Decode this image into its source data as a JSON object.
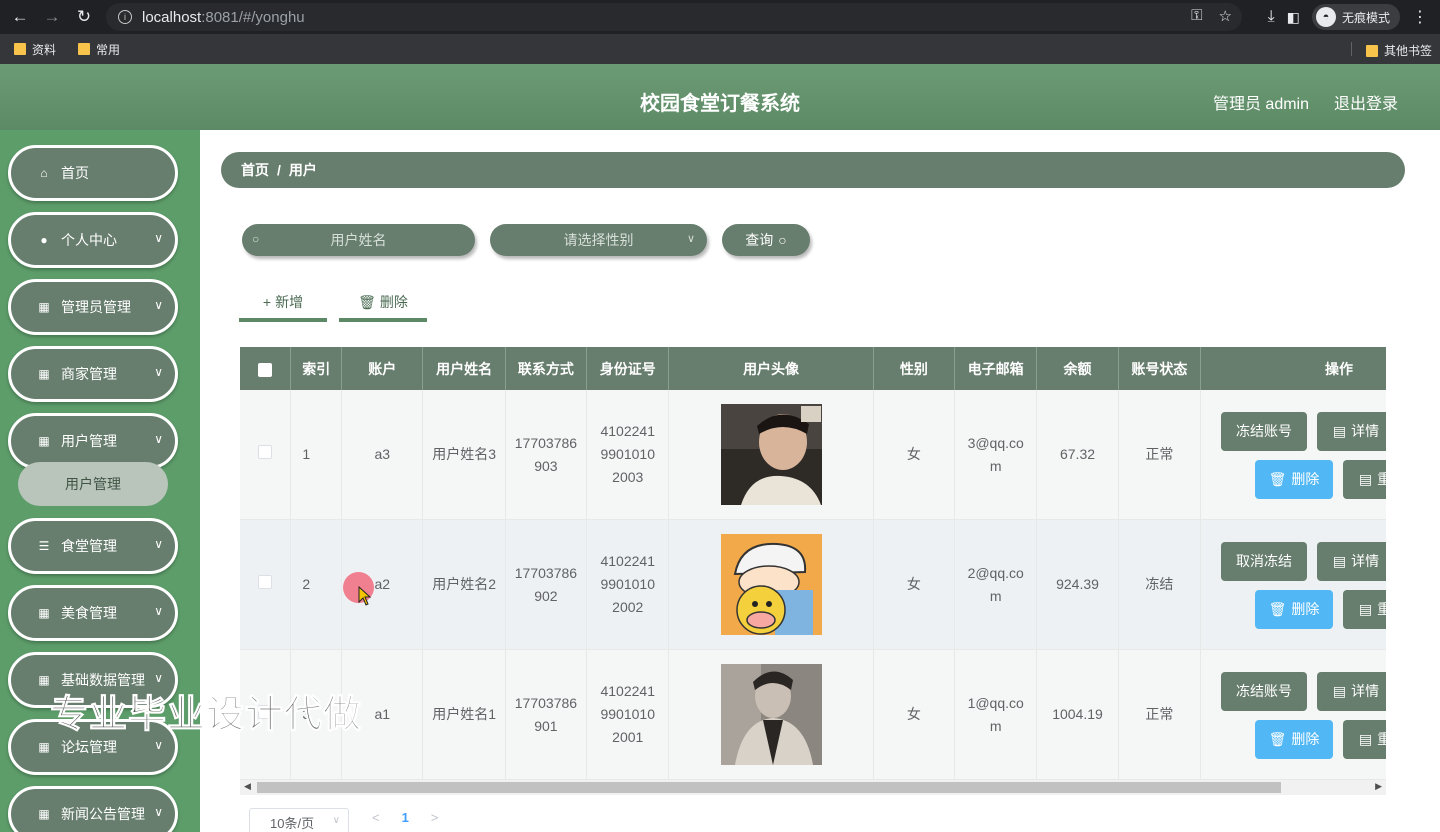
{
  "browser": {
    "url_host": "localhost",
    "url_rest": ":8081/#/yonghu",
    "incognito_label": "无痕模式",
    "bookmarks": [
      "资料",
      "常用"
    ],
    "other_bookmarks": "其他书签"
  },
  "header": {
    "title": "校园食堂订餐系统",
    "user": "管理员 admin",
    "logout": "退出登录"
  },
  "sidebar": {
    "items": [
      {
        "label": "首页",
        "icon": "home-icon"
      },
      {
        "label": "个人中心",
        "icon": "user-icon"
      },
      {
        "label": "管理员管理",
        "icon": "grid-icon"
      },
      {
        "label": "商家管理",
        "icon": "grid-icon"
      },
      {
        "label": "用户管理",
        "icon": "grid-icon"
      },
      {
        "label": "食堂管理",
        "icon": "sliders-icon"
      },
      {
        "label": "美食管理",
        "icon": "grid-icon"
      },
      {
        "label": "基础数据管理",
        "icon": "grid-icon"
      },
      {
        "label": "论坛管理",
        "icon": "grid-icon"
      },
      {
        "label": "新闻公告管理",
        "icon": "grid-icon"
      }
    ],
    "submenu": "用户管理"
  },
  "breadcrumb": {
    "home": "首页",
    "sep": "/",
    "current": "用户"
  },
  "search": {
    "name_placeholder": "用户姓名",
    "gender_placeholder": "请选择性别",
    "query": "查询"
  },
  "actions": {
    "add": "新增",
    "delete": "删除"
  },
  "table": {
    "columns": [
      "索引",
      "账户",
      "用户姓名",
      "联系方式",
      "身份证号",
      "用户头像",
      "性别",
      "电子邮箱",
      "余额",
      "账号状态",
      "操作"
    ],
    "rows": [
      {
        "index": "1",
        "account": "a3",
        "name": "用户姓名3",
        "phone": "17703786903",
        "id_card": "410224199010102003",
        "gender": "女",
        "email": "3@qq.com",
        "balance": "67.32",
        "status": "正常",
        "status_action": "冻结账号"
      },
      {
        "index": "2",
        "account": "a2",
        "name": "用户姓名2",
        "phone": "17703786902",
        "id_card": "410224199010102002",
        "gender": "女",
        "email": "2@qq.com",
        "balance": "924.39",
        "status": "冻结",
        "status_action": "取消冻结"
      },
      {
        "index": "3",
        "account": "a1",
        "name": "用户姓名1",
        "phone": "17703786901",
        "id_card": "410224199010102001",
        "gender": "女",
        "email": "1@qq.com",
        "balance": "1004.19",
        "status": "正常",
        "status_action": "冻结账号"
      }
    ],
    "op_labels": {
      "detail": "详情",
      "delete": "删除",
      "reset": "重置"
    }
  },
  "pagination": {
    "page_size": "10条/页",
    "current_page": "1"
  },
  "watermark": "专业毕业设计代做",
  "colors": {
    "header_green": "#5d8a66",
    "sidebar_green": "#5d9d6a",
    "widget_green": "#677d6d",
    "blue_button": "#52b7f5"
  }
}
